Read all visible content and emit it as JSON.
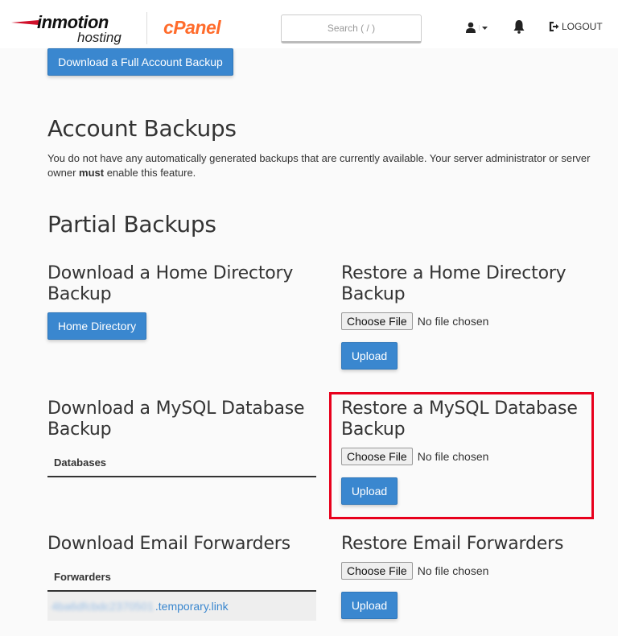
{
  "header": {
    "logo_brand": "inmotion",
    "logo_sub": "hosting",
    "logo_cpanel": "cPanel",
    "search_placeholder": "Search ( / )",
    "user_icon": "user-icon",
    "notifications_icon": "bell-icon",
    "logout_label": "LOGOUT"
  },
  "full_backup": {
    "button_label": "Download a Full Account Backup"
  },
  "account_backups": {
    "title": "Account Backups",
    "text_before": "You do not have any automatically generated backups that are currently available. Your server administrator or server owner ",
    "text_bold": "must",
    "text_after": " enable this feature."
  },
  "partial_backups": {
    "title": "Partial Backups",
    "home_download": {
      "title_line1": "Download a Home Directory",
      "title_line2": "Backup",
      "button_label": "Home Directory"
    },
    "home_restore": {
      "title_line1": "Restore a Home Directory",
      "title_line2": "Backup",
      "choose_label": "Choose File",
      "file_status": "No file chosen",
      "upload_label": "Upload"
    },
    "mysql_download": {
      "title_line1": "Download a MySQL Database",
      "title_line2": "Backup",
      "table_header": "Databases"
    },
    "mysql_restore": {
      "title_line1": "Restore a MySQL Database",
      "title_line2": "Backup",
      "choose_label": "Choose File",
      "file_status": "No file chosen",
      "upload_label": "Upload"
    },
    "email_download": {
      "title": "Download Email Forwarders",
      "table_header": "Forwarders",
      "rows": [
        {
          "blurred_prefix": "4ba6dfcbdc2370501",
          "domain_suffix": ".temporary.link"
        }
      ]
    },
    "email_restore": {
      "title": "Restore Email Forwarders",
      "choose_label": "Choose File",
      "file_status": "No file chosen",
      "upload_label": "Upload"
    }
  },
  "colors": {
    "primary_button": "#3a87cf",
    "cpanel_orange": "#ff6c2c",
    "highlight": "#e8001c"
  }
}
